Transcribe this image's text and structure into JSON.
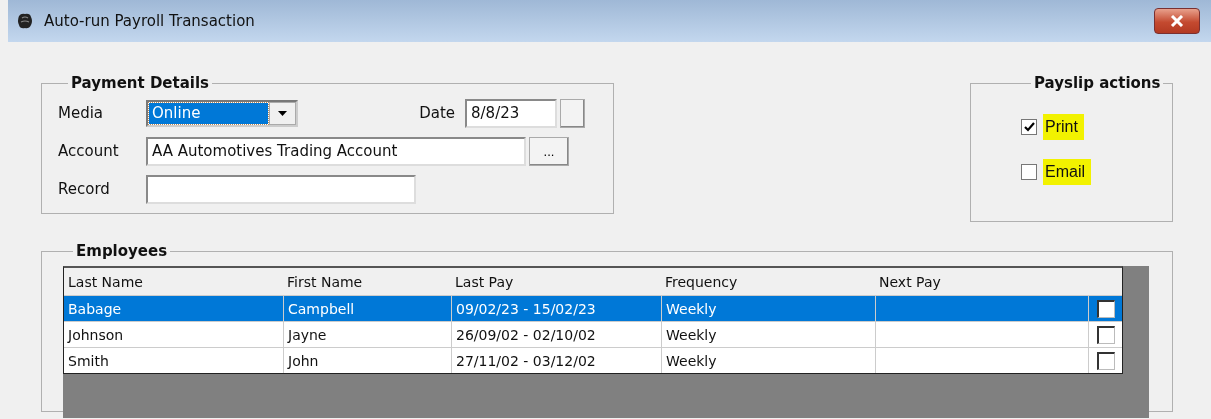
{
  "window": {
    "title": "Auto-run Payroll Transaction"
  },
  "payment_details": {
    "title": "Payment Details",
    "media": {
      "label": "Media",
      "value": "Online"
    },
    "date": {
      "label": "Date",
      "value": "8/8/23"
    },
    "account": {
      "label": "Account",
      "value": "AA Automotives Trading Account",
      "button": "..."
    },
    "record": {
      "label": "Record"
    }
  },
  "payslip_actions": {
    "title": "Payslip actions",
    "options": [
      {
        "label": "Print",
        "checked": true
      },
      {
        "label": "Email",
        "checked": false
      }
    ]
  },
  "employees": {
    "title": "Employees",
    "columns": [
      "Last Name",
      "First Name",
      "Last Pay",
      "Frequency",
      "Next Pay"
    ],
    "rows": [
      {
        "cells": [
          "Babage",
          "Campbell",
          "09/02/23 - 15/02/23",
          "Weekly"
        ],
        "selected": true,
        "checked": false
      },
      {
        "cells": [
          "Johnson",
          "Jayne",
          "26/09/02 - 02/10/02",
          "Weekly"
        ],
        "selected": false,
        "checked": false
      },
      {
        "cells": [
          "Smith",
          "John",
          "27/11/02 - 03/12/02",
          "Weekly"
        ],
        "selected": false,
        "checked": false
      }
    ]
  }
}
